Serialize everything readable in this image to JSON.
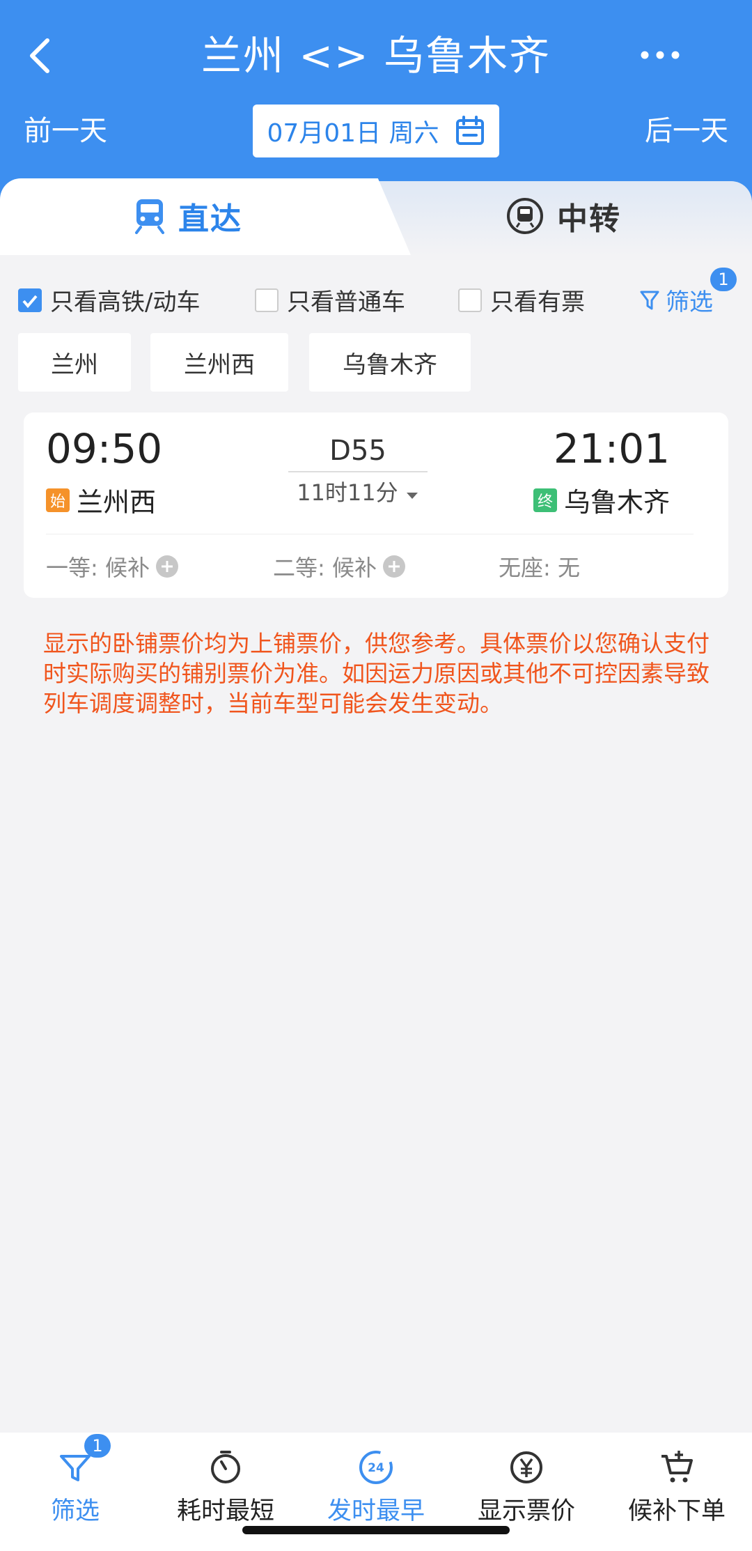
{
  "header": {
    "title": "兰州 <> 乌鲁木齐",
    "prev_day": "前一天",
    "next_day": "后一天",
    "date": "07月01日 周六"
  },
  "tabs": {
    "direct": "直达",
    "transfer": "中转"
  },
  "filters": {
    "high_speed": "只看高铁/动车",
    "regular": "只看普通车",
    "available": "只看有票",
    "filter_label": "筛选",
    "filter_badge": "1"
  },
  "stations": [
    "兰州",
    "兰州西",
    "乌鲁木齐"
  ],
  "train": {
    "departure_time": "09:50",
    "arrival_time": "21:01",
    "number": "D55",
    "duration": "11时11分",
    "departure_badge": "始",
    "departure_station": "兰州西",
    "arrival_badge": "终",
    "arrival_station": "乌鲁木齐",
    "seats": {
      "first_class": "一等: 候补",
      "second_class": "二等: 候补",
      "no_seat": "无座: 无"
    }
  },
  "notice": "显示的卧铺票价均为上铺票价，供您参考。具体票价以您确认支付时实际购买的铺别票价为准。如因运力原因或其他不可控因素导致列车调度调整时，当前车型可能会发生变动。",
  "bottom_bar": {
    "filter": "筛选",
    "filter_badge": "1",
    "shortest": "耗时最短",
    "earliest": "发时最早",
    "price": "显示票价",
    "waitlist": "候补下单",
    "earliest_icon_text": "24"
  },
  "colors": {
    "primary": "#3d8ff0",
    "notice": "#f0551d",
    "start_badge": "#f5922a",
    "end_badge": "#3dbf76"
  }
}
